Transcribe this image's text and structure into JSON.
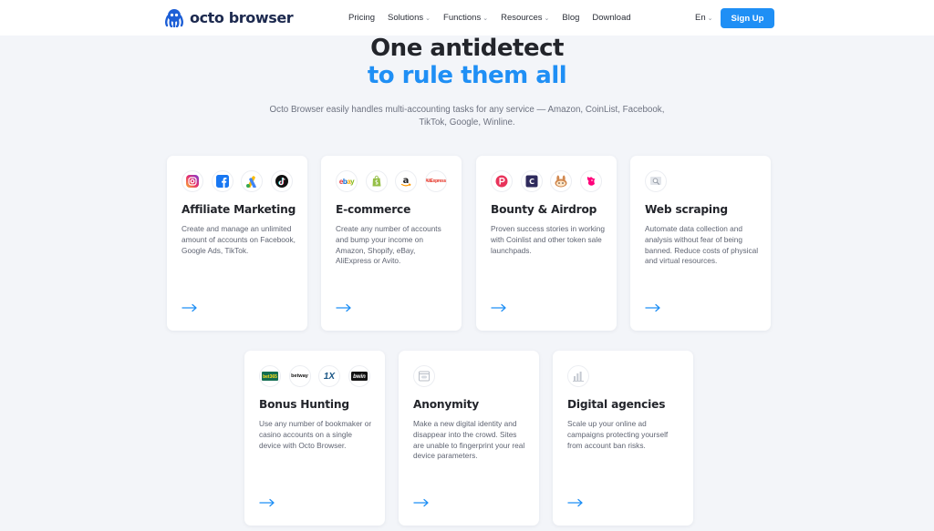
{
  "brand": {
    "name": "octo browser",
    "accent": "#1f8ff5",
    "dark": "#1d2a4f"
  },
  "nav": {
    "items": [
      {
        "label": "Pricing",
        "has_dropdown": false
      },
      {
        "label": "Solutions",
        "has_dropdown": true
      },
      {
        "label": "Functions",
        "has_dropdown": true
      },
      {
        "label": "Resources",
        "has_dropdown": true
      },
      {
        "label": "Blog",
        "has_dropdown": false
      },
      {
        "label": "Download",
        "has_dropdown": false
      }
    ],
    "language": "En",
    "signup_label": "Sign Up"
  },
  "hero": {
    "line1": "One antidetect",
    "line2": "to rule them all",
    "subtitle": "Octo Browser easily handles multi-accounting tasks for any service — Amazon, CoinList, Facebook, TikTok, Google, Winline."
  },
  "cards": [
    {
      "title": "Affiliate Marketing",
      "description": "Create and manage an unlimited amount of accounts on Facebook, Google Ads, TikTok.",
      "icons": [
        "instagram-icon",
        "facebook-icon",
        "google-ads-icon",
        "tiktok-icon"
      ]
    },
    {
      "title": "E-commerce",
      "description": "Create any number of accounts and bump your income on Amazon, Shopify, eBay, AliExpress or Avito.",
      "icons": [
        "ebay-icon",
        "shopify-icon",
        "amazon-icon",
        "aliexpress-icon"
      ],
      "icon_text": {
        "ebay": "ebay",
        "shopify": "shopify",
        "amazon": "a",
        "aliexpress": "AliExpress"
      }
    },
    {
      "title": "Bounty & Airdrop",
      "description": "Proven success stories in working with Coinlist and other token sale launchpads.",
      "icons": [
        "launchpad-icon",
        "coinlist-icon",
        "pancakeswap-icon",
        "uniswap-icon"
      ],
      "icon_text": {
        "coinlist": "C"
      }
    },
    {
      "title": "Web scraping",
      "description": "Automate data collection and analysis without fear of being banned. Reduce costs of physical and virtual resources.",
      "icons": [
        "magnifier-icon"
      ]
    },
    {
      "title": "Bonus Hunting",
      "description": "Use any number of bookmaker or casino accounts on a single device with Octo Browser.",
      "icons": [
        "bet365-icon",
        "betway-icon",
        "1xbet-icon",
        "bwin-icon"
      ],
      "icon_text": {
        "bet365": "bet365",
        "betway": "betway",
        "onex": "1X",
        "bwin": "bwin"
      }
    },
    {
      "title": "Anonymity",
      "description": "Make a new digital identity and disappear into the crowd. Sites are unable to fingerprint your real device parameters.",
      "icons": [
        "mask-icon"
      ]
    },
    {
      "title": "Digital agencies",
      "description": "Scale up your online ad campaigns protecting yourself from account ban risks.",
      "icons": [
        "bar-chart-icon"
      ]
    }
  ]
}
